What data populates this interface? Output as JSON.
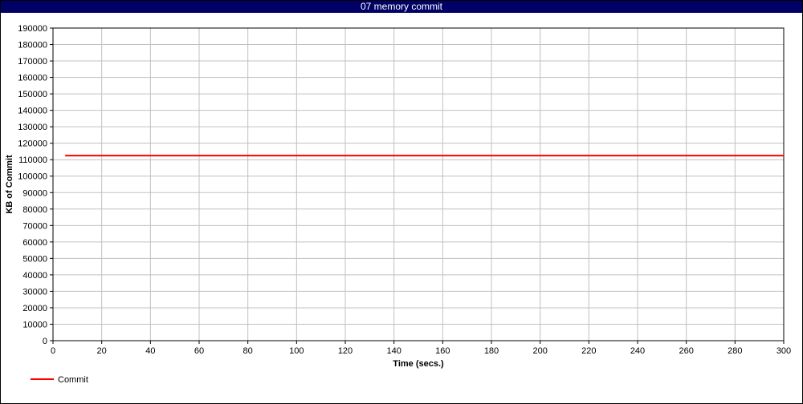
{
  "window": {
    "title": "07 memory commit"
  },
  "chart_data": {
    "type": "line",
    "xlabel": "Time (secs.)",
    "ylabel": "KB of Commit",
    "xlim": [
      0,
      300
    ],
    "ylim": [
      0,
      190000
    ],
    "xticks": [
      0,
      20,
      40,
      60,
      80,
      100,
      120,
      140,
      160,
      180,
      200,
      220,
      240,
      260,
      280,
      300
    ],
    "yticks": [
      0,
      10000,
      20000,
      30000,
      40000,
      50000,
      60000,
      70000,
      80000,
      90000,
      100000,
      110000,
      120000,
      130000,
      140000,
      150000,
      160000,
      170000,
      180000,
      190000
    ],
    "grid": true,
    "legend_position": "bottom-left",
    "series": [
      {
        "name": "Commit",
        "color": "#ff0000",
        "x": [
          5,
          300
        ],
        "y": [
          112500,
          112500
        ]
      }
    ]
  }
}
